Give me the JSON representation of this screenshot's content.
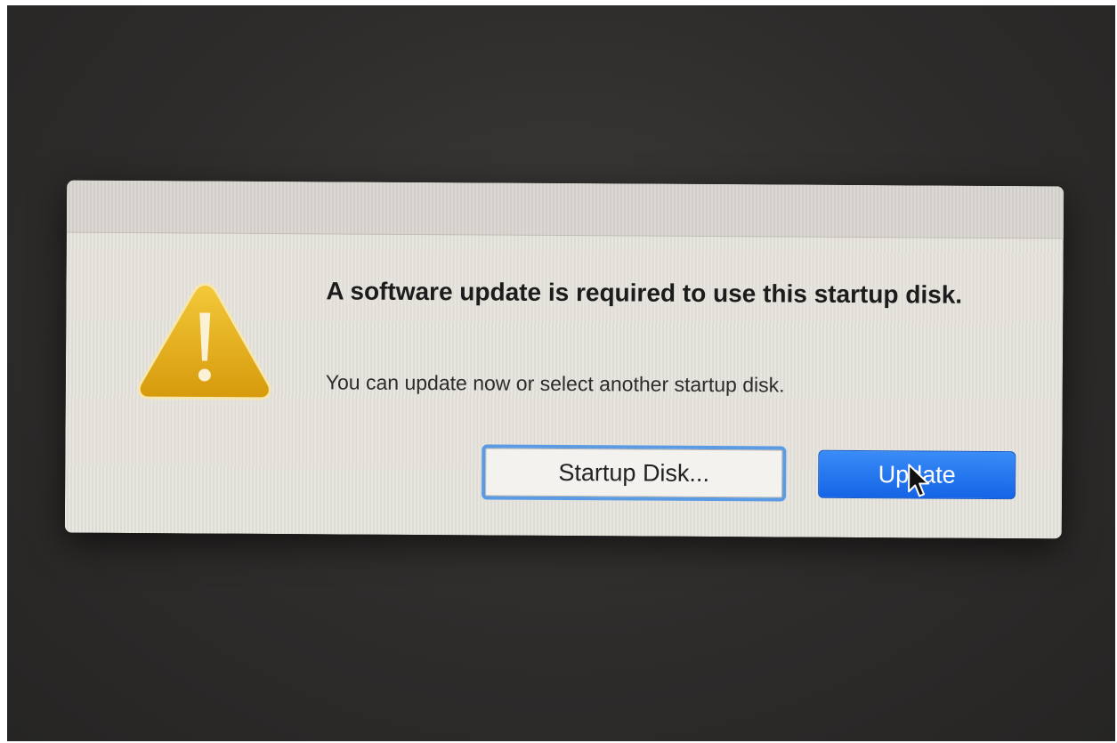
{
  "dialog": {
    "title": "A software update is required to use this startup disk.",
    "message": "You can update now or select another startup disk.",
    "buttons": {
      "startup_disk_label": "Startup Disk...",
      "update_label": "Update"
    },
    "icon": "warning-icon"
  },
  "colors": {
    "screen_background": "#2e2c2b",
    "dialog_background": "#e6e3dd",
    "accent_blue": "#1f6fed",
    "focus_ring": "#5b9be4",
    "warning_yellow": "#e8b419"
  }
}
